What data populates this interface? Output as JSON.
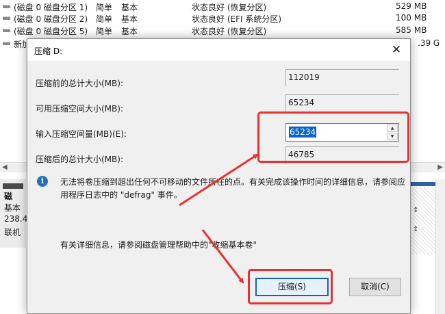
{
  "volumes": [
    {
      "name": "(磁盘 0 磁盘分区 1)",
      "layout": "简单",
      "type": "基本",
      "status": "状态良好 (恢复分区)",
      "size": "529 MB"
    },
    {
      "name": "(磁盘 0 磁盘分区 2)",
      "layout": "简单",
      "type": "基本",
      "status": "状态良好 (EFI 系统分区)",
      "size": "100 MB"
    },
    {
      "name": "(磁盘 0 磁盘分区 5)",
      "layout": "简单",
      "type": "基本",
      "status": "状态良好 (恢复分区)",
      "size": "585 MB"
    },
    {
      "name": "新加",
      "layout": "",
      "type": "",
      "status": "",
      "size": ".39 G"
    }
  ],
  "disk_panel": {
    "line1": "磁",
    "line2": "基本",
    "line3": "238.4",
    "line4": "联机"
  },
  "dialog": {
    "title": "压缩 D:",
    "close_glyph": "✕",
    "total_before_label": "压缩前的总计大小(MB):",
    "total_before_value": "112019",
    "available_label": "可用压缩空间大小(MB):",
    "available_value": "65234",
    "input_label": "输入压缩空间量(MB)(E):",
    "input_value": "65234",
    "total_after_label": "压缩后的总计大小(MB):",
    "total_after_value": "46785",
    "info_icon": "i",
    "info_text": "无法将卷压缩到超出任何不可移动的文件所在的点。有关完成该操作时间的详细信息，请参阅应用程序日志中的 \"defrag\" 事件。",
    "help_text": "有关详细信息，请参阅磁盘管理帮助中的\"收缩基本卷\"",
    "shrink_button": "压缩(S)",
    "cancel_button": "取消(C)"
  },
  "colors": {
    "annotation": "#e8312f",
    "selection": "#0a64c8",
    "info_icon": "#1e73be"
  }
}
